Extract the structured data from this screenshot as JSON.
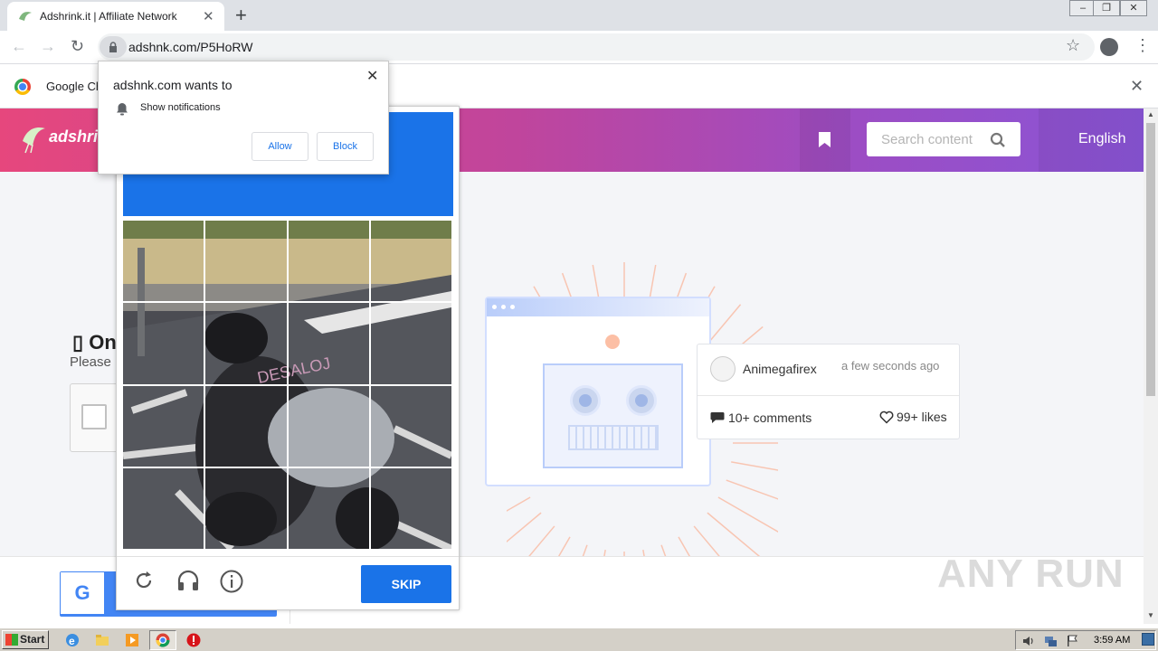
{
  "browser": {
    "tab_title": "Adshrink.it | Affiliate Network",
    "url": "adshnk.com/P5HoRW",
    "infobar_text": "Google Ch"
  },
  "site": {
    "logo_text": "adshrin",
    "search_placeholder": "Search content",
    "language": "English"
  },
  "page": {
    "heading": "On",
    "please_text": "Please"
  },
  "card": {
    "user": "Animegafirex",
    "time": "a few seconds ago",
    "comments": "10+ comments",
    "likes": "99+ likes"
  },
  "captcha": {
    "skip_label": "SKIP",
    "grid_rows": 4,
    "grid_cols": 4
  },
  "permission": {
    "title": "adshnk.com wants to",
    "request": "Show notifications",
    "allow_label": "Allow",
    "block_label": "Block"
  },
  "taskbar": {
    "start_label": "Start",
    "clock": "3:59 AM"
  },
  "watermark": "ANY RUN"
}
